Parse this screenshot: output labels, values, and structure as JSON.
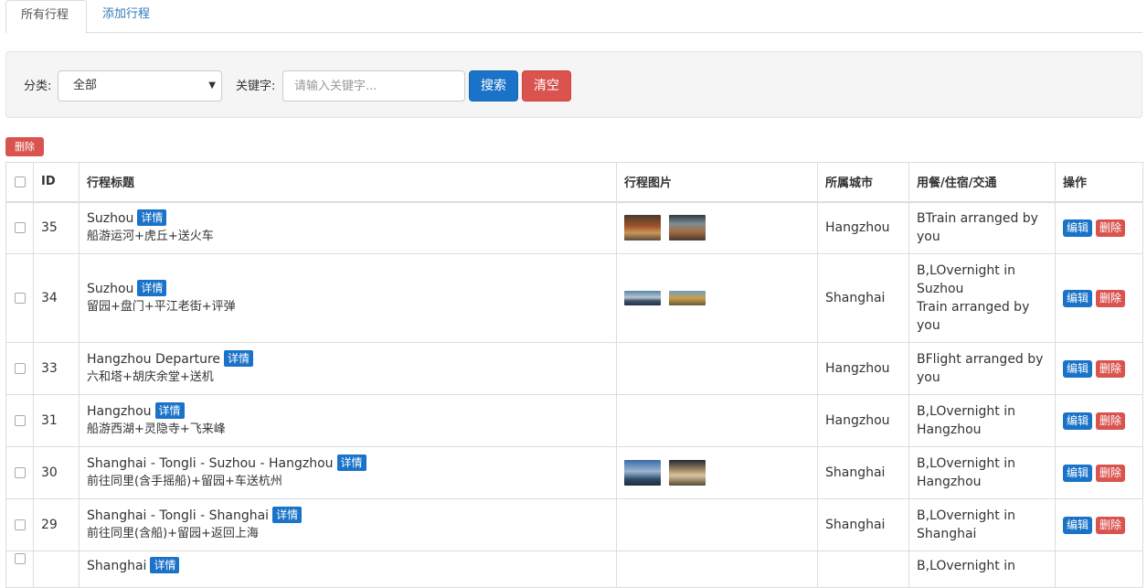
{
  "tabs": [
    "所有行程",
    "添加行程"
  ],
  "filter": {
    "category_label": "分类:",
    "category_value": "全部",
    "keyword_label": "关键字:",
    "keyword_placeholder": "请输入关键字...",
    "search_label": "搜索",
    "clear_label": "清空"
  },
  "bulk_delete_label": "删除",
  "table": {
    "headers": [
      "ID",
      "行程标题",
      "行程图片",
      "所属城市",
      "用餐/住宿/交通",
      "操作"
    ],
    "detail_label": "详情",
    "edit_label": "编辑",
    "delete_label": "删除",
    "rows": [
      {
        "id": "35",
        "title": "Suzhou",
        "subtitle": "船游运河+虎丘+送火车",
        "images": 2,
        "city": "Hangzhou",
        "meal": [
          "BTrain arranged by",
          "you"
        ]
      },
      {
        "id": "34",
        "title": "Suzhou",
        "subtitle": "留园+盘门+平江老街+评弹",
        "images": 2,
        "city": "Shanghai",
        "meal": [
          "B,LOvernight in",
          "Suzhou",
          "Train arranged by",
          "you"
        ]
      },
      {
        "id": "33",
        "title": "Hangzhou Departure",
        "subtitle": "六和塔+胡庆余堂+送机",
        "images": 0,
        "city": "Hangzhou",
        "meal": [
          "BFlight arranged by",
          "you"
        ]
      },
      {
        "id": "31",
        "title": "Hangzhou",
        "subtitle": "船游西湖+灵隐寺+飞来峰",
        "images": 0,
        "city": "Hangzhou",
        "meal": [
          "B,LOvernight in",
          "Hangzhou"
        ]
      },
      {
        "id": "30",
        "title": "Shanghai - Tongli - Suzhou - Hangzhou",
        "subtitle": "前往同里(含手摇船)+留园+车送杭州",
        "images": 2,
        "city": "Shanghai",
        "meal": [
          "B,LOvernight in",
          "Hangzhou"
        ]
      },
      {
        "id": "29",
        "title": "Shanghai - Tongli - Shanghai",
        "subtitle": "前往同里(含船)+留园+返回上海",
        "images": 0,
        "city": "Shanghai",
        "meal": [
          "B,LOvernight in",
          "Shanghai"
        ]
      },
      {
        "id": "",
        "title": "Shanghai",
        "subtitle": "",
        "images": 0,
        "city": "",
        "meal": [
          "B,LOvernight in"
        ]
      }
    ]
  }
}
